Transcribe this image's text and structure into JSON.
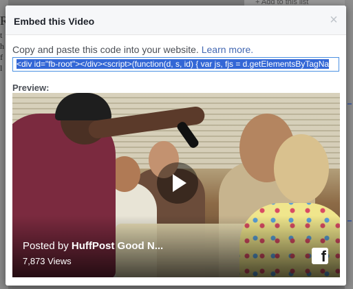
{
  "background": {
    "top_right_text": "+ Add to this list",
    "left_chars": [
      "R",
      "t",
      "h",
      "f",
      "l"
    ]
  },
  "dialog": {
    "title": "Embed this Video",
    "close_label": "×",
    "instructions": "Copy and paste this code into your website.",
    "learn_more": "Learn more.",
    "embed_code": "<div id=\"fb-root\"></div><script>(function(d, s, id) {  var js, fjs = d.getElementsByTagNa",
    "preview_label": "Preview:"
  },
  "video": {
    "posted_by_prefix": "Posted by ",
    "page_name": "HuffPost Good N...",
    "views": "7,873 Views",
    "platform_icon": "facebook-icon",
    "play_icon": "play-icon"
  },
  "colors": {
    "link": "#4267b2",
    "title": "#1d2129",
    "selection": "#3367d6",
    "field_border": "#4a90e2"
  }
}
